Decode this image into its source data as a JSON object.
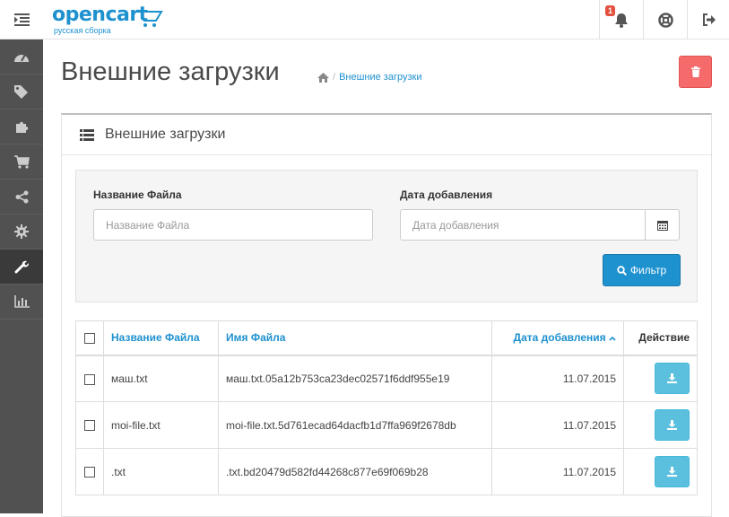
{
  "header": {
    "logo_main": "opencart",
    "logo_sub": "русская сборка",
    "notification_count": "1"
  },
  "page": {
    "title": "Внешние загрузки",
    "breadcrumb_sep": "/",
    "breadcrumb_link": "Внешние загрузки"
  },
  "panel": {
    "title": "Внешние загрузки"
  },
  "filter": {
    "name_label": "Название Файла",
    "name_placeholder": "Название Файла",
    "date_label": "Дата добавления",
    "date_placeholder": "Дата добавления",
    "button_label": "Фильтр"
  },
  "table": {
    "columns": [
      "Название Файла",
      "Имя Файла",
      "Дата добавления",
      "Действие"
    ],
    "rows": [
      {
        "name": "маш.txt",
        "filename": "маш.txt.05a12b753ca23dec02571f6ddf955e19",
        "date": "11.07.2015"
      },
      {
        "name": "moi-file.txt",
        "filename": "moi-file.txt.5d761ecad64dacfb1d7ffa969f2678db",
        "date": "11.07.2015"
      },
      {
        "name": ".txt",
        "filename": ".txt.bd20479d582fd44268c877e69f069b28",
        "date": "11.07.2015"
      }
    ]
  },
  "colors": {
    "primary": "#1e91cf",
    "danger": "#f56b6b",
    "info": "#5bc0de",
    "sidebar": "#515151"
  }
}
